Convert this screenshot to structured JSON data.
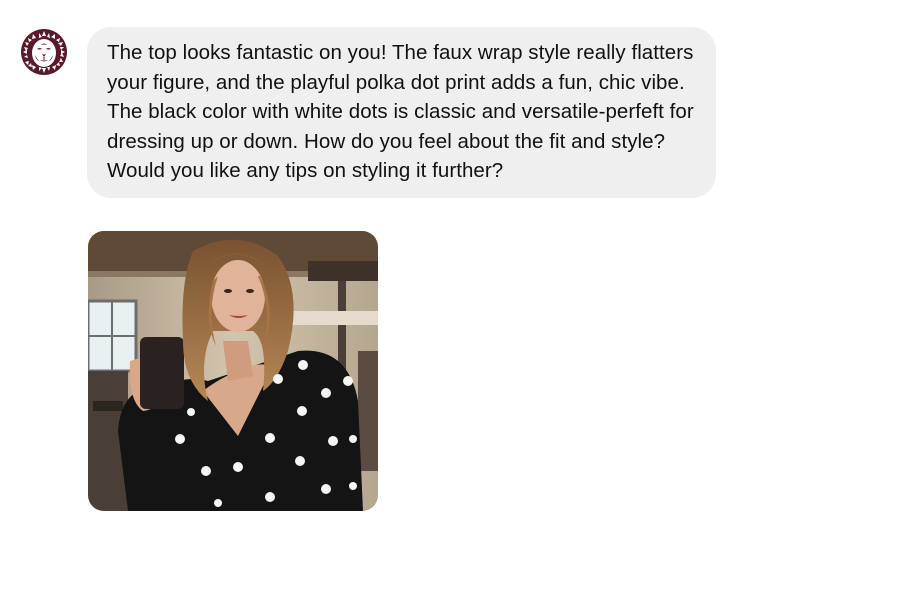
{
  "conversation": {
    "avatar_icon": "lion-logo-icon",
    "brand_color": "#5a1a2a",
    "message": {
      "text": "The top looks fantastic on you! The faux wrap style really flatters your figure, and the playful polka dot print adds a fun, chic vibe. The black color with white dots is classic and versatile-perfeft for dressing up or down. How do you feel about the fit and style? Would you like any tips on styling it further?",
      "bubble_color": "#efefef"
    },
    "attachment": {
      "type": "image",
      "subject": "selfie-photo"
    }
  }
}
